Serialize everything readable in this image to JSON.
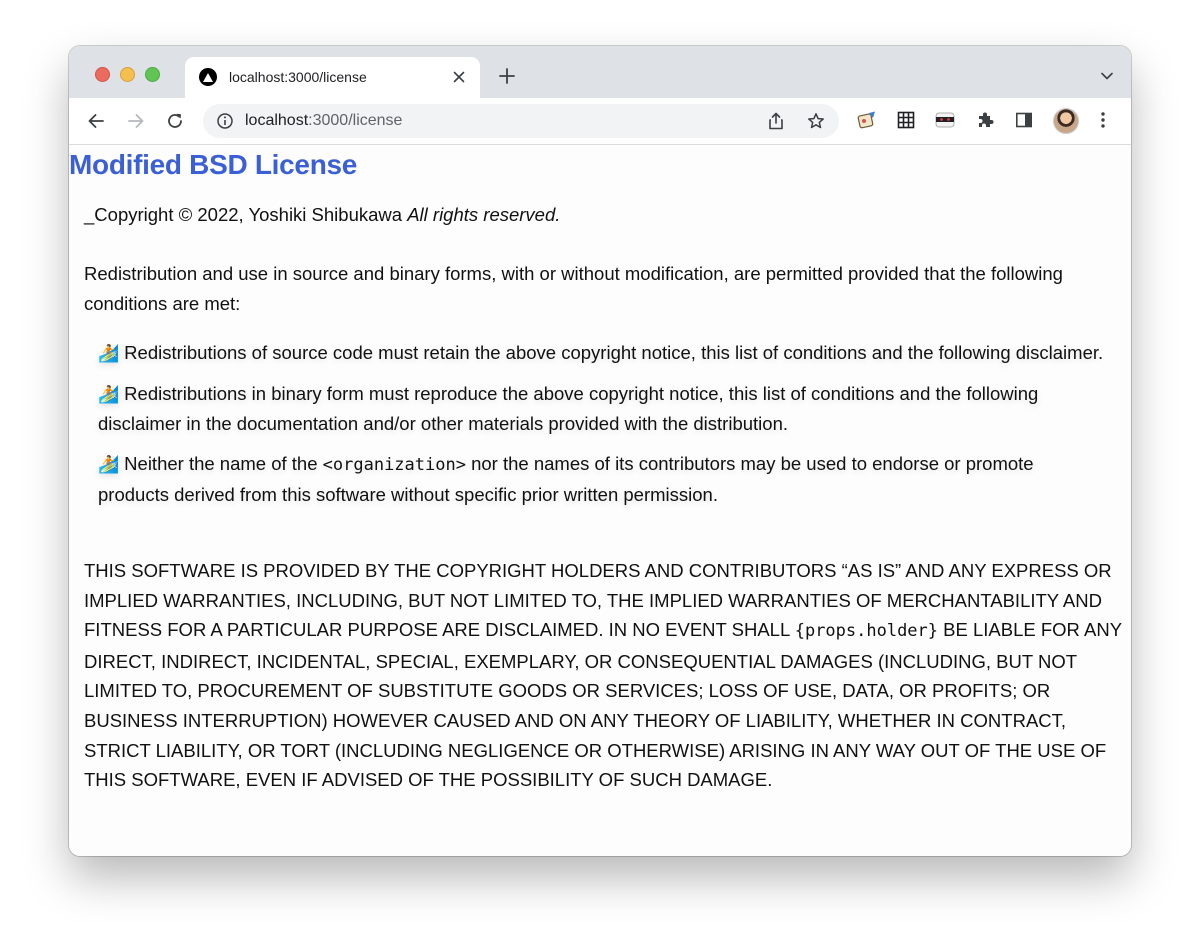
{
  "browser": {
    "tab_title": "localhost:3000/license",
    "url_host": "localhost",
    "url_rest": ":3000/license"
  },
  "page": {
    "title": "Modified BSD License",
    "copyright_prefix": "_Copyright © 2022, Yoshiki Shibukawa ",
    "copyright_em": "All rights reserved.",
    "intro": "Redistribution and use in source and binary forms, with or without modification, are permitted provided that the following conditions are met:",
    "bullet_glyph": "🏄",
    "conditions": [
      {
        "text": "Redistributions of source code must retain the above copyright notice, this list of conditions and the following disclaimer."
      },
      {
        "text": "Redistributions in binary form must reproduce the above copyright notice, this list of conditions and the following disclaimer in the documentation and/or other materials provided with the distribution."
      },
      {
        "before": "Neither the name of the ",
        "code": "<organization>",
        "after": " nor the names of its contributors may be used to endorse or promote products derived from this software without specific prior written permission."
      }
    ],
    "disclaimer_before": "THIS SOFTWARE IS PROVIDED BY THE COPYRIGHT HOLDERS AND CONTRIBUTORS “AS IS” AND ANY EXPRESS OR IMPLIED WARRANTIES, INCLUDING, BUT NOT LIMITED TO, THE IMPLIED WARRANTIES OF MERCHANTABILITY AND FITNESS FOR A PARTICULAR PURPOSE ARE DISCLAIMED. IN NO EVENT SHALL ",
    "disclaimer_code": "{props.holder}",
    "disclaimer_after": " BE LIABLE FOR ANY DIRECT, INDIRECT, INCIDENTAL, SPECIAL, EXEMPLARY, OR CONSEQUENTIAL DAMAGES (INCLUDING, BUT NOT LIMITED TO, PROCUREMENT OF SUBSTITUTE GOODS OR SERVICES; LOSS OF USE, DATA, OR PROFITS; OR BUSINESS INTERRUPTION) HOWEVER CAUSED AND ON ANY THEORY OF LIABILITY, WHETHER IN CONTRACT, STRICT LIABILITY, OR TORT (INCLUDING NEGLIGENCE OR OTHERWISE) ARISING IN ANY WAY OUT OF THE USE OF THIS SOFTWARE, EVEN IF ADVISED OF THE POSSIBILITY OF SUCH DAMAGE."
  },
  "colors": {
    "title": "#3b5fd6",
    "tabbar": "#dee1e6",
    "omnibox": "#f1f3f4"
  },
  "icons": [
    "close-window-light",
    "minimize-window-light",
    "zoom-window-light",
    "vercel-triangle-icon",
    "close-icon",
    "plus-icon",
    "chevron-down-icon",
    "back-arrow-icon",
    "forward-arrow-icon",
    "reload-icon",
    "info-icon",
    "share-icon",
    "star-icon",
    "paint-extension-icon",
    "grid-extension-icon",
    "mask-extension-icon",
    "puzzle-extensions-icon",
    "side-panel-icon",
    "profile-avatar",
    "kebab-menu-icon",
    "surfer-bullet-icon"
  ]
}
